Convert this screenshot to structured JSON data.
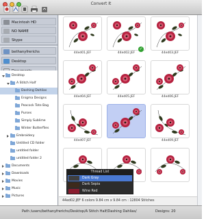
{
  "window": {
    "title": "Convert It"
  },
  "toolbar": {
    "icons": [
      "hoop-icon",
      "stitch-icon",
      "view-icon",
      "printer-icon",
      "export-icon"
    ]
  },
  "sources": [
    {
      "label": "Macintosh HD",
      "icon": "hard-drive-icon"
    },
    {
      "label": "NO NAME",
      "icon": "drive-icon"
    },
    {
      "label": "Skype",
      "icon": "drive-icon"
    },
    {
      "label": "bethanyfrerichs",
      "icon": "home-icon"
    },
    {
      "label": "Desktop",
      "icon": "desktop-icon"
    },
    {
      "label": "Documents",
      "icon": "documents-icon"
    }
  ],
  "tree": [
    {
      "label": "Desktop",
      "level": 0,
      "open": true
    },
    {
      "label": "A Stitch Half",
      "level": 1,
      "open": true
    },
    {
      "label": "Dashing Dahlias",
      "level": 2,
      "selected": true
    },
    {
      "label": "Enigma Designs",
      "level": 2
    },
    {
      "label": "Peacock Tote Bag",
      "level": 2
    },
    {
      "label": "Purses",
      "level": 2
    },
    {
      "label": "Simply Sublime",
      "level": 2
    },
    {
      "label": "Winter Butterflies",
      "level": 2
    },
    {
      "label": "Embroidery",
      "level": 1,
      "closed": true
    },
    {
      "label": "Untitled CD folder",
      "level": 1
    },
    {
      "label": "untitled folder",
      "level": 1
    },
    {
      "label": "untitled folder 2",
      "level": 1
    },
    {
      "label": "Documents",
      "level": 0,
      "closed": true
    },
    {
      "label": "Downloads",
      "level": 0,
      "closed": true
    },
    {
      "label": "Movies",
      "level": 0,
      "closed": true
    },
    {
      "label": "Music",
      "level": 0,
      "closed": true
    },
    {
      "label": "Pictures",
      "level": 0,
      "closed": true
    }
  ],
  "designs": [
    {
      "file": "44ed01.JEF",
      "motif": "corner"
    },
    {
      "file": "44ed02.JEF",
      "motif": "corner",
      "checked": true
    },
    {
      "file": "44ed03.JEF",
      "motif": "corner"
    },
    {
      "file": "44ed04.JEF",
      "motif": "diagonal"
    },
    {
      "file": "44ed05.JEF",
      "motif": "diagonal"
    },
    {
      "file": "44ed06.JEF",
      "motif": "diagonal"
    },
    {
      "file": "44ed07.JEF",
      "motif": "corner-bottom"
    },
    {
      "file": "",
      "motif": "diagonal",
      "selected": true
    },
    {
      "file": "44ed09.JEF",
      "motif": "corner-bottom"
    },
    {
      "file": "",
      "motif": "strip"
    },
    {
      "file": "",
      "motif": "strip"
    },
    {
      "file": "",
      "motif": "strip"
    }
  ],
  "info": {
    "text": "44ed02.JEF 6 colors 9.84 cm x 9.84 cm : 12804 Stitches"
  },
  "thread_list": {
    "title": "Thread List",
    "threads": [
      {
        "name": "Dark Gray",
        "color": "#3f3f3f",
        "selected": true
      },
      {
        "name": "Dark Sepia",
        "color": "#3d2a1c"
      },
      {
        "name": "Wine Red",
        "color": "#8a1d2f"
      }
    ]
  },
  "status": {
    "path": "Path  /users/bethanyfrerichs/Desktop/A Stitch Half/Dashing Dahlias/",
    "designs": "Designs:  20"
  },
  "colors": {
    "selection": "#c2cff4",
    "flower": "#b5213f",
    "leaf": "#2f3a1e",
    "check": "#31a131"
  }
}
